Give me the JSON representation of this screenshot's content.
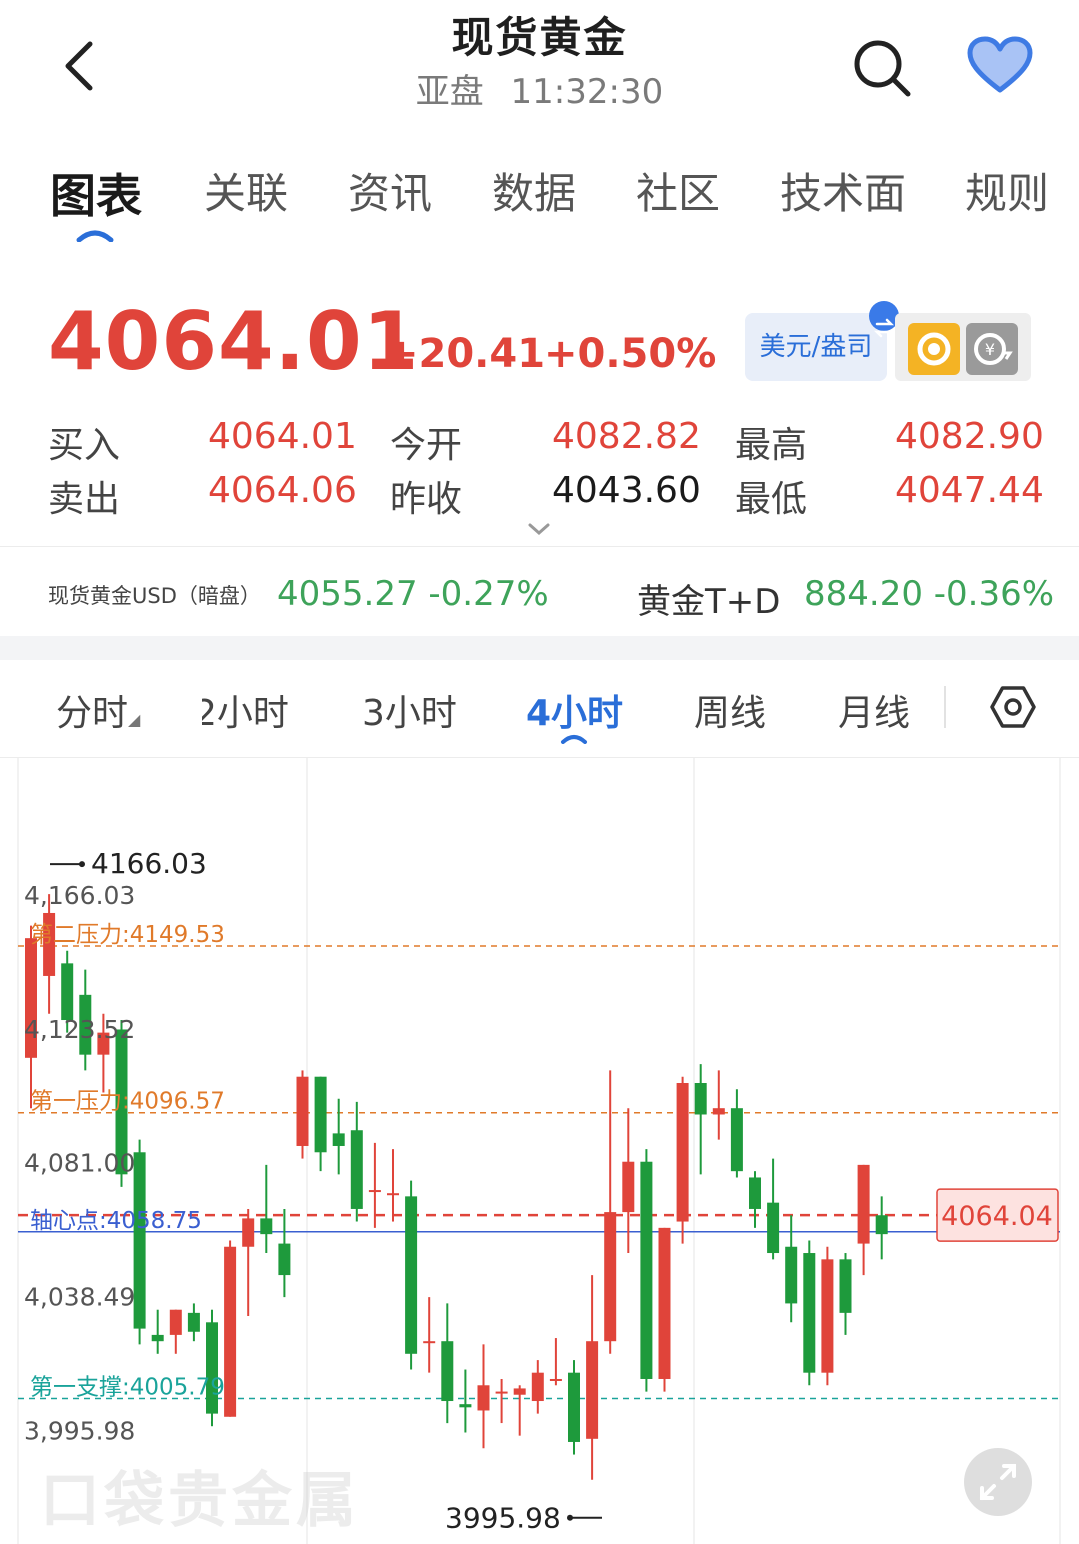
{
  "header": {
    "title": "现货黄金",
    "session": "亚盘",
    "time": "11:32:30"
  },
  "main_tabs": [
    {
      "label": "图表",
      "active": true
    },
    {
      "label": "关联"
    },
    {
      "label": "资讯"
    },
    {
      "label": "数据"
    },
    {
      "label": "社区"
    },
    {
      "label": "技术面"
    },
    {
      "label": "规则"
    }
  ],
  "price": {
    "last": "4064.01",
    "change": "+20.41",
    "change_pct": "+0.50%",
    "currency_button": "美元/盎司"
  },
  "quote": {
    "bid_label": "买入",
    "bid": "4064.01",
    "ask_label": "卖出",
    "ask": "4064.06",
    "open_label": "今开",
    "open": "4082.82",
    "prev_close_label": "昨收",
    "prev_close": "4043.60",
    "high_label": "最高",
    "high": "4082.90",
    "low_label": "最低",
    "low": "4047.44"
  },
  "related": [
    {
      "name": "现货黄金USD（暗盘）",
      "value": "4055.27 -0.27%"
    },
    {
      "name": "黄金T+D",
      "value": "884.20 -0.36%"
    }
  ],
  "period_tabs": [
    {
      "label": "分时"
    },
    {
      "label": "2小时"
    },
    {
      "label": "3小时"
    },
    {
      "label": "4小时",
      "active": true
    },
    {
      "label": "周线"
    },
    {
      "label": "月线"
    }
  ],
  "watermark": "口袋贵金属",
  "colors": {
    "up": "#e0443a",
    "down": "#1e9a3c",
    "accent": "#2a6ed8",
    "resistance": "#e07a2a",
    "support": "#1aa39a",
    "pivot": "#3a5fd0"
  },
  "chart_data": {
    "type": "candlestick",
    "ylim": [
      3985,
      4180
    ],
    "y_ticks": [
      "4,166.03",
      "4,123.52",
      "4,081.00",
      "4,038.49",
      "3,995.98"
    ],
    "y_tick_values": [
      4166.03,
      4123.52,
      4081.0,
      4038.49,
      3995.98
    ],
    "max_marker": "4166.03",
    "min_marker": "3995.98",
    "current_price_tag": "4064.04",
    "current_price": 4064.04,
    "levels": [
      {
        "label": "第二压力:4149.53",
        "value": 4149.53,
        "kind": "resistance"
      },
      {
        "label": "第一压力:4096.57",
        "value": 4096.57,
        "kind": "resistance"
      },
      {
        "label": "轴心点:4058.75",
        "value": 4058.75,
        "kind": "pivot"
      },
      {
        "label": "第一支撑:4005.79",
        "value": 4005.79,
        "kind": "support"
      }
    ],
    "candles": [
      {
        "o": 4114,
        "h": 4156,
        "l": 4098,
        "c": 4152
      },
      {
        "o": 4140,
        "h": 4166,
        "l": 4128,
        "c": 4160
      },
      {
        "o": 4144,
        "h": 4148,
        "l": 4122,
        "c": 4126
      },
      {
        "o": 4134,
        "h": 4142,
        "l": 4110,
        "c": 4115
      },
      {
        "o": 4115,
        "h": 4128,
        "l": 4103,
        "c": 4122
      },
      {
        "o": 4123,
        "h": 4126,
        "l": 4073,
        "c": 4077
      },
      {
        "o": 4084,
        "h": 4088,
        "l": 4023,
        "c": 4028
      },
      {
        "o": 4026,
        "h": 4034,
        "l": 4020,
        "c": 4024
      },
      {
        "o": 4026,
        "h": 4034,
        "l": 4020,
        "c": 4034
      },
      {
        "o": 4033,
        "h": 4036,
        "l": 4024,
        "c": 4027
      },
      {
        "o": 4030,
        "h": 4034,
        "l": 3997,
        "c": 4001
      },
      {
        "o": 4000,
        "h": 4056,
        "l": 4000,
        "c": 4054
      },
      {
        "o": 4054,
        "h": 4066,
        "l": 4032,
        "c": 4063
      },
      {
        "o": 4063,
        "h": 4080,
        "l": 4052,
        "c": 4058
      },
      {
        "o": 4055,
        "h": 4066,
        "l": 4038,
        "c": 4045
      },
      {
        "o": 4086,
        "h": 4110,
        "l": 4082,
        "c": 4108
      },
      {
        "o": 4108,
        "h": 4108,
        "l": 4078,
        "c": 4084
      },
      {
        "o": 4090,
        "h": 4101,
        "l": 4077,
        "c": 4086
      },
      {
        "o": 4091,
        "h": 4100,
        "l": 4062,
        "c": 4066
      },
      {
        "o": 4072,
        "h": 4087,
        "l": 4060,
        "c": 4072
      },
      {
        "o": 4071,
        "h": 4085,
        "l": 4062,
        "c": 4071
      },
      {
        "o": 4070,
        "h": 4075,
        "l": 4015,
        "c": 4020
      },
      {
        "o": 4024,
        "h": 4038,
        "l": 4014,
        "c": 4024
      },
      {
        "o": 4024,
        "h": 4036,
        "l": 3998,
        "c": 4005
      },
      {
        "o": 4004,
        "h": 4015,
        "l": 3995,
        "c": 4003
      },
      {
        "o": 4002,
        "h": 4023,
        "l": 3990,
        "c": 4010
      },
      {
        "o": 4008,
        "h": 4012,
        "l": 3998,
        "c": 4008
      },
      {
        "o": 4007,
        "h": 4010,
        "l": 3994,
        "c": 4009
      },
      {
        "o": 4005,
        "h": 4018,
        "l": 4001,
        "c": 4014
      },
      {
        "o": 4012,
        "h": 4025,
        "l": 4010,
        "c": 4012
      },
      {
        "o": 4014,
        "h": 4018,
        "l": 3988,
        "c": 3992
      },
      {
        "o": 3993,
        "h": 4045,
        "l": 3980,
        "c": 4024
      },
      {
        "o": 4024,
        "h": 4110,
        "l": 4020,
        "c": 4065
      },
      {
        "o": 4065,
        "h": 4098,
        "l": 4052,
        "c": 4081
      },
      {
        "o": 4081,
        "h": 4085,
        "l": 4008,
        "c": 4012
      },
      {
        "o": 4012,
        "h": 4060,
        "l": 4008,
        "c": 4060
      },
      {
        "o": 4062,
        "h": 4108,
        "l": 4055,
        "c": 4106
      },
      {
        "o": 4106,
        "h": 4112,
        "l": 4077,
        "c": 4096
      },
      {
        "o": 4096,
        "h": 4110,
        "l": 4088,
        "c": 4098
      },
      {
        "o": 4098,
        "h": 4104,
        "l": 4076,
        "c": 4078
      },
      {
        "o": 4076,
        "h": 4078,
        "l": 4060,
        "c": 4066
      },
      {
        "o": 4068,
        "h": 4082,
        "l": 4050,
        "c": 4052
      },
      {
        "o": 4054,
        "h": 4064,
        "l": 4030,
        "c": 4036
      },
      {
        "o": 4052,
        "h": 4056,
        "l": 4010,
        "c": 4014
      },
      {
        "o": 4014,
        "h": 4054,
        "l": 4010,
        "c": 4050
      },
      {
        "o": 4050,
        "h": 4052,
        "l": 4026,
        "c": 4033
      },
      {
        "o": 4055,
        "h": 4080,
        "l": 4045,
        "c": 4080
      },
      {
        "o": 4064,
        "h": 4070,
        "l": 4050,
        "c": 4058
      }
    ]
  }
}
